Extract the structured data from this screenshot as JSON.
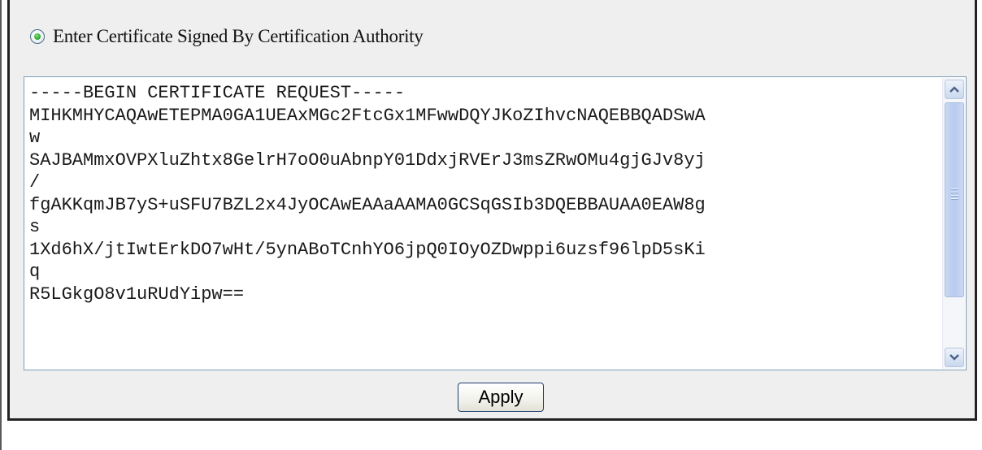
{
  "form": {
    "option_label": "Enter Certificate Signed By Certification Authority",
    "option_selected": true,
    "certificate_lines": [
      "-----BEGIN CERTIFICATE REQUEST-----",
      "MIHKMHYCAQAwETEPMA0GA1UEAxMGc2FtcGx1MFwwDQYJKoZIhvcNAQEBBQADSwA",
      "w",
      "SAJBAMmxOVPXluZhtx8GelrH7oO0uAbnpY01DdxjRVErJ3msZRwOMu4gjGJv8yj",
      "/",
      "fgAKKqmJB7yS+uSFU7BZL2x4JyOCAwEAAaAAMA0GCSqGSIb3DQEBBAUAA0EAW8g",
      "s",
      "1Xd6hX/jtIwtErkDO7wHt/5ynABoTCnhYO6jpQ0IOyOZDwppi6uzsf96lpD5sKi",
      "q",
      "R5LGkgO8v1uRUdYipw=="
    ],
    "apply_label": "Apply"
  },
  "icons": {
    "radio": "radio-selected-icon",
    "scroll_up": "scroll-up-arrow-icon",
    "scroll_down": "scroll-down-arrow-icon"
  },
  "colors": {
    "radio_dot": "#24a324",
    "panel_bg": "#efefef",
    "scrollbar_thumb": "#b8cbef",
    "field_border": "#7f9db9"
  }
}
